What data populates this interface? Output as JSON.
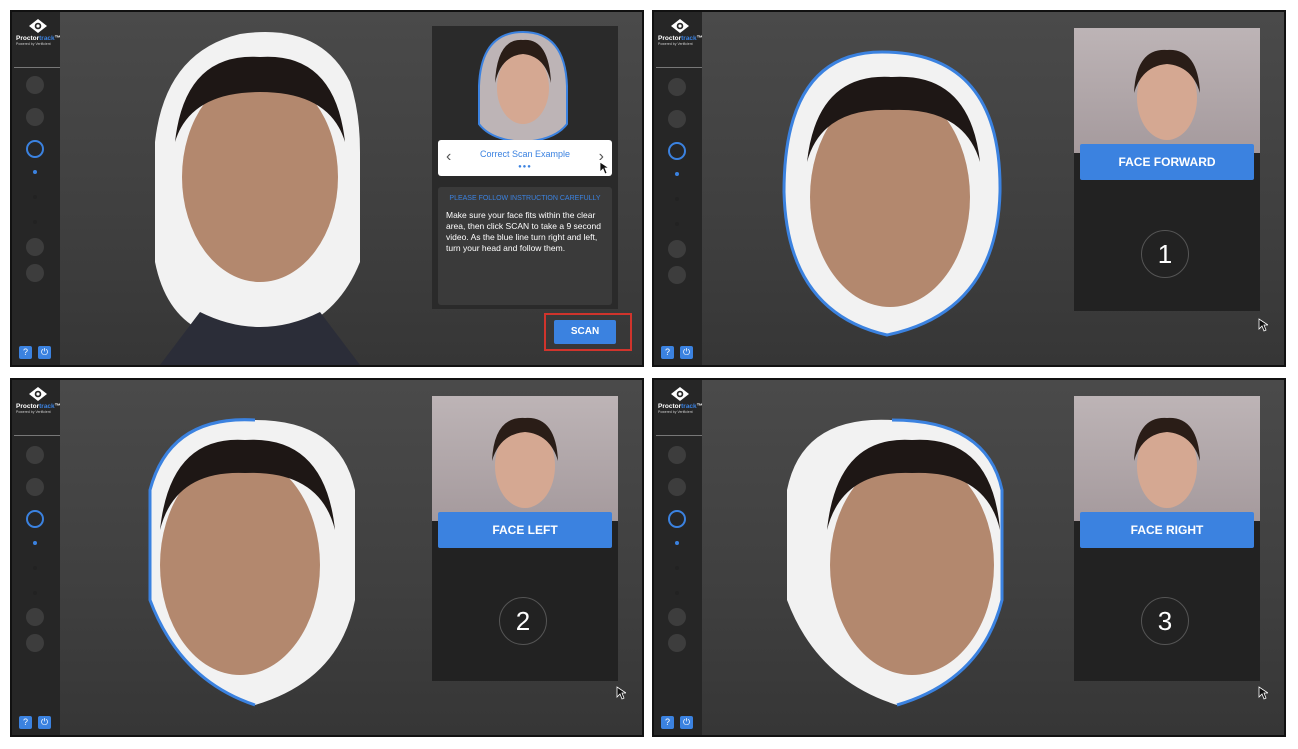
{
  "app": {
    "brand_main": "Proctor",
    "brand_accent": "track",
    "brand_tm": "™",
    "brand_sub": "Powered by Verificient",
    "help_icon": "?",
    "power_icon": "⏻"
  },
  "colors": {
    "accent": "#3b82e0",
    "panel_bg": "#3c3c3c",
    "sidebar_bg": "#262626",
    "scan_highlight": "#d0342c"
  },
  "panel1": {
    "carousel_title": "Correct Scan Example",
    "instruction_header": "PLEASE FOLLOW INSTRUCTION CAREFULLY",
    "instruction_body": "Make sure your face fits within the clear area, then click SCAN to take a 9 second video. As the blue line turn right and left, turn your head and follow them.",
    "scan_button": "SCAN",
    "prev_icon": "chevron-left-icon",
    "next_icon": "chevron-right-icon"
  },
  "panel2": {
    "instruction": "FACE FORWARD",
    "step": "1"
  },
  "panel3": {
    "instruction": "FACE LEFT",
    "step": "2"
  },
  "panel4": {
    "instruction": "FACE RIGHT",
    "step": "3"
  }
}
